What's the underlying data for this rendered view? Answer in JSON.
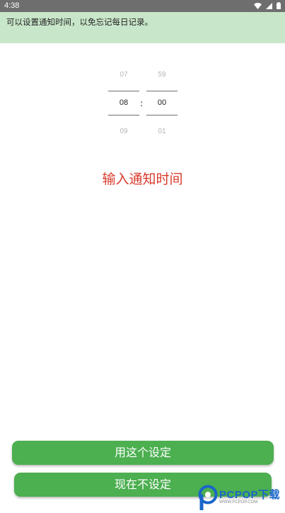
{
  "status_bar": {
    "time": "4:38",
    "icons": [
      "wifi-icon",
      "signal-icon",
      "battery-icon"
    ]
  },
  "notice": {
    "text": "可以设置通知时间，以免忘记每日记录。"
  },
  "time_picker": {
    "hour": {
      "prev": "07",
      "selected": "08",
      "next": "09"
    },
    "minute": {
      "prev": "59",
      "selected": "00",
      "next": "01"
    },
    "separator": ":"
  },
  "prompt": {
    "title": "输入通知时间",
    "color": "#d93a2b"
  },
  "buttons": {
    "use_setting": "用这个设定",
    "skip_setting": "现在不设定",
    "color": "#4caf50"
  },
  "watermark": {
    "brand": "PCPOP下载",
    "subtitle": "WWW.PCPOP.COM"
  },
  "colors": {
    "status_bar": "#6e6e6e",
    "notice_bg": "#c8e6c9",
    "accent_red": "#d93a2b",
    "accent_green": "#4caf50"
  }
}
